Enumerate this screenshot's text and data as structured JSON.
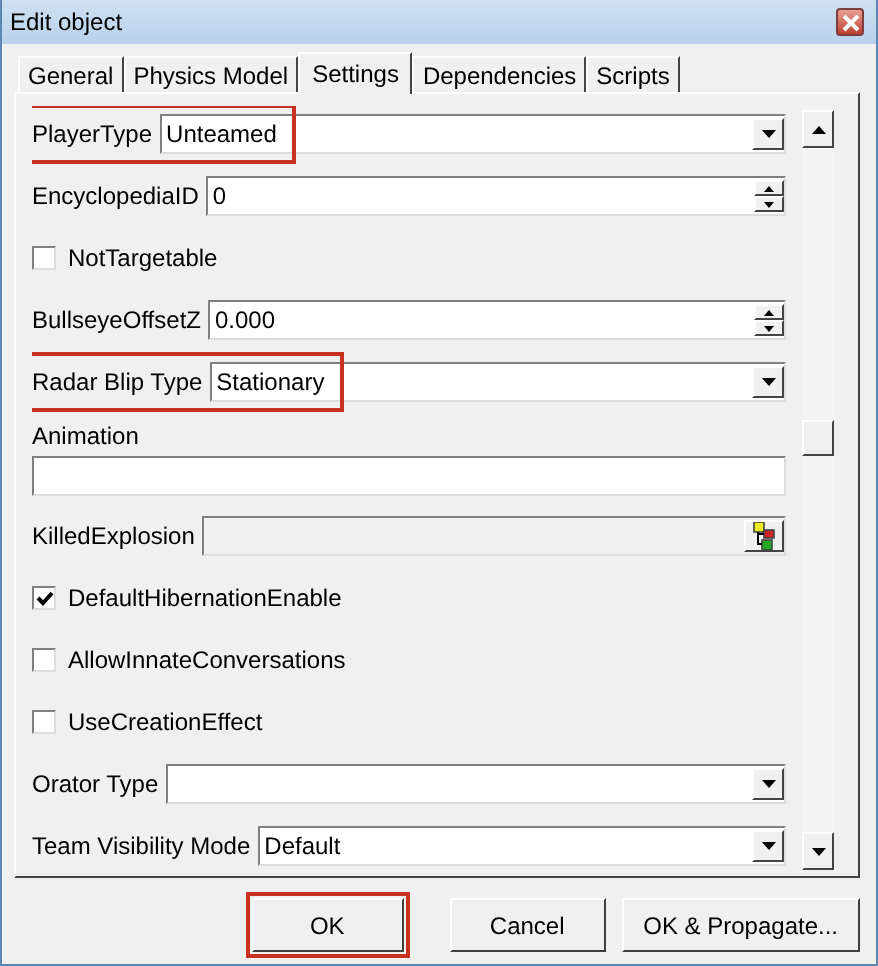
{
  "window": {
    "title": "Edit object"
  },
  "tabs": [
    {
      "label": "General",
      "selected": false
    },
    {
      "label": "Physics Model",
      "selected": false
    },
    {
      "label": "Settings",
      "selected": true
    },
    {
      "label": "Dependencies",
      "selected": false
    },
    {
      "label": "Scripts",
      "selected": false
    }
  ],
  "fields": [
    {
      "kind": "combo",
      "label": "PlayerType",
      "value": "Unteamed",
      "highlighted": true
    },
    {
      "kind": "spin",
      "label": "EncyclopediaID",
      "value": "0"
    },
    {
      "kind": "checkbox",
      "label": "NotTargetable",
      "checked": false
    },
    {
      "kind": "spin",
      "label": "BullseyeOffsetZ",
      "value": "0.000"
    },
    {
      "kind": "combo",
      "label": "Radar Blip Type",
      "value": "Stationary",
      "highlighted": true
    },
    {
      "kind": "text",
      "label": "Animation"
    },
    {
      "kind": "picker",
      "label": "KilledExplosion"
    },
    {
      "kind": "checkbox",
      "label": "DefaultHibernationEnable",
      "checked": true
    },
    {
      "kind": "checkbox",
      "label": "AllowInnateConversations",
      "checked": false
    },
    {
      "kind": "checkbox",
      "label": "UseCreationEffect",
      "checked": false
    },
    {
      "kind": "combo",
      "label": "Orator Type",
      "highlighted": false
    },
    {
      "kind": "combo",
      "label": "Team Visibility Mode",
      "value": "Default",
      "highlighted": false
    }
  ],
  "buttons": [
    {
      "label": "OK",
      "highlighted": true
    },
    {
      "label": "Cancel",
      "highlighted": false
    },
    {
      "label": "OK & Propagate...",
      "highlighted": false
    }
  ]
}
